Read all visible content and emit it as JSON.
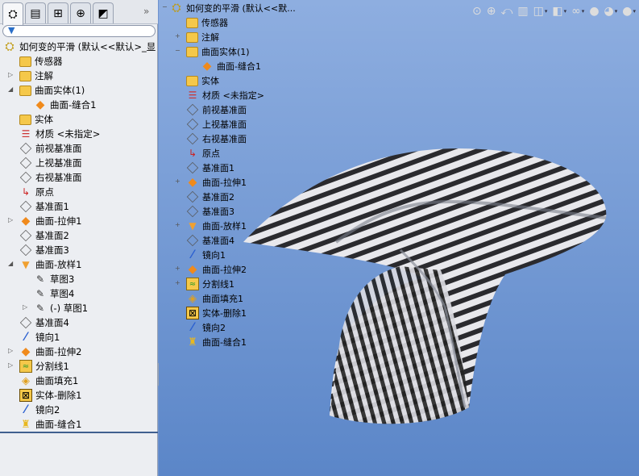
{
  "panel_tabs": [
    {
      "name": "featuremanager",
      "glyph": "⛭"
    },
    {
      "name": "propertymanager",
      "glyph": "▤"
    },
    {
      "name": "configurationmanager",
      "glyph": "⊞"
    },
    {
      "name": "dimxpert",
      "glyph": "⊕"
    },
    {
      "name": "display-manager",
      "glyph": "◩"
    }
  ],
  "more_label": "»",
  "filter_icon": "▼",
  "left_tree": [
    {
      "label": "如何变的平滑 (默认<<默认>_显",
      "icon": "part",
      "level": 0
    },
    {
      "label": "传感器",
      "icon": "folder",
      "level": 1
    },
    {
      "label": "注解",
      "icon": "folder",
      "level": 1,
      "expander": "▷"
    },
    {
      "label": "曲面实体(1)",
      "icon": "folder",
      "level": 1,
      "expander": "◢"
    },
    {
      "label": "曲面-缝合1",
      "icon": "surface",
      "level": 2
    },
    {
      "label": "实体",
      "icon": "folder",
      "level": 1
    },
    {
      "label": "材质 <未指定>",
      "icon": "material",
      "level": 1
    },
    {
      "label": "前视基准面",
      "icon": "plane",
      "level": 1
    },
    {
      "label": "上视基准面",
      "icon": "plane",
      "level": 1
    },
    {
      "label": "右视基准面",
      "icon": "plane",
      "level": 1
    },
    {
      "label": "原点",
      "icon": "origin",
      "level": 1
    },
    {
      "label": "基准面1",
      "icon": "plane",
      "level": 1
    },
    {
      "label": "曲面-拉伸1",
      "icon": "surface",
      "level": 1,
      "expander": "▷"
    },
    {
      "label": "基准面2",
      "icon": "plane",
      "level": 1
    },
    {
      "label": "基准面3",
      "icon": "plane",
      "level": 1
    },
    {
      "label": "曲面-放样1",
      "icon": "loft",
      "level": 1,
      "expander": "◢"
    },
    {
      "label": "草图3",
      "icon": "sketch",
      "level": 2
    },
    {
      "label": "草图4",
      "icon": "sketch",
      "level": 2
    },
    {
      "label": "(-) 草图1",
      "icon": "sketch",
      "level": 2,
      "expander": "▷"
    },
    {
      "label": "基准面4",
      "icon": "plane",
      "level": 1
    },
    {
      "label": "镜向1",
      "icon": "mirror",
      "level": 1
    },
    {
      "label": "曲面-拉伸2",
      "icon": "surface",
      "level": 1,
      "expander": "▷"
    },
    {
      "label": "分割线1",
      "icon": "split",
      "level": 1,
      "expander": "▷"
    },
    {
      "label": "曲面填充1",
      "icon": "fill",
      "level": 1
    },
    {
      "label": "实体-删除1",
      "icon": "delete",
      "level": 1
    },
    {
      "label": "镜向2",
      "icon": "mirror",
      "level": 1
    },
    {
      "label": "曲面-缝合1",
      "icon": "knit",
      "level": 1
    }
  ],
  "viewport_tree": [
    {
      "label": "如何变的平滑 (默认<<默...",
      "icon": "part",
      "level": 0,
      "expander": "−"
    },
    {
      "label": "传感器",
      "icon": "folder",
      "level": 1
    },
    {
      "label": "注解",
      "icon": "folder",
      "level": 1,
      "expander": "+"
    },
    {
      "label": "曲面实体(1)",
      "icon": "folder",
      "level": 1,
      "expander": "−"
    },
    {
      "label": "曲面-缝合1",
      "icon": "surface",
      "level": 2
    },
    {
      "label": "实体",
      "icon": "folder",
      "level": 1
    },
    {
      "label": "材质 <未指定>",
      "icon": "material",
      "level": 1
    },
    {
      "label": "前视基准面",
      "icon": "plane",
      "level": 1
    },
    {
      "label": "上视基准面",
      "icon": "plane",
      "level": 1
    },
    {
      "label": "右视基准面",
      "icon": "plane",
      "level": 1
    },
    {
      "label": "原点",
      "icon": "origin",
      "level": 1
    },
    {
      "label": "基准面1",
      "icon": "plane",
      "level": 1
    },
    {
      "label": "曲面-拉伸1",
      "icon": "surface",
      "level": 1,
      "expander": "+"
    },
    {
      "label": "基准面2",
      "icon": "plane",
      "level": 1
    },
    {
      "label": "基准面3",
      "icon": "plane",
      "level": 1
    },
    {
      "label": "曲面-放样1",
      "icon": "loft",
      "level": 1,
      "expander": "+"
    },
    {
      "label": "基准面4",
      "icon": "plane",
      "level": 1
    },
    {
      "label": "镜向1",
      "icon": "mirror",
      "level": 1
    },
    {
      "label": "曲面-拉伸2",
      "icon": "surface",
      "level": 1,
      "expander": "+"
    },
    {
      "label": "分割线1",
      "icon": "split",
      "level": 1,
      "expander": "+"
    },
    {
      "label": "曲面填充1",
      "icon": "fill",
      "level": 1
    },
    {
      "label": "实体-删除1",
      "icon": "delete",
      "level": 1
    },
    {
      "label": "镜向2",
      "icon": "mirror",
      "level": 1
    },
    {
      "label": "曲面-缝合1",
      "icon": "knit",
      "level": 1
    }
  ],
  "toolbar": [
    {
      "name": "zoom-to-fit",
      "glyph": "⊙"
    },
    {
      "name": "zoom-to-area",
      "glyph": "⊕"
    },
    {
      "name": "previous-view",
      "glyph": "⤺"
    },
    {
      "name": "section-view",
      "glyph": "▥"
    },
    {
      "name": "view-orientation",
      "glyph": "◫",
      "dropdown": true
    },
    {
      "name": "display-style",
      "glyph": "◧",
      "dropdown": true
    },
    {
      "name": "hide-show-items",
      "glyph": "∞",
      "dropdown": true
    },
    {
      "name": "edit-appearance",
      "glyph": "●"
    },
    {
      "name": "apply-scene",
      "glyph": "◕",
      "dropdown": true
    },
    {
      "name": "view-settings",
      "glyph": "●",
      "dropdown": true
    }
  ],
  "colors": {
    "viewport_top": "#8eaee0",
    "viewport_bottom": "#5b86c8",
    "panel": "#eceef2",
    "folder": "#f5c84a"
  }
}
